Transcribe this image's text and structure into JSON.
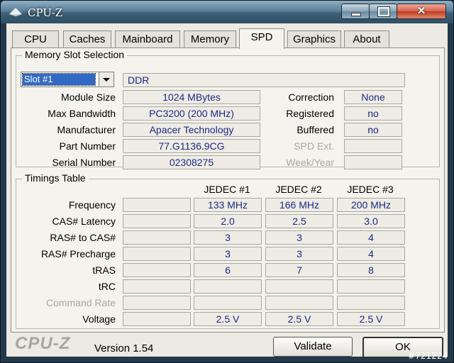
{
  "window": {
    "title": "CPU-Z",
    "close_glyph": "✕"
  },
  "tabs": [
    "CPU",
    "Caches",
    "Mainboard",
    "Memory",
    "SPD",
    "Graphics",
    "About"
  ],
  "active_tab": "SPD",
  "slot": {
    "group_title": "Memory Slot Selection",
    "selected": "Slot #1",
    "type": "DDR",
    "rows": [
      {
        "label": "Module Size",
        "value": "1024 MBytes"
      },
      {
        "label": "Max Bandwidth",
        "value": "PC3200 (200 MHz)"
      },
      {
        "label": "Manufacturer",
        "value": "Apacer Technology"
      },
      {
        "label": "Part Number",
        "value": "77.G1136.9CG"
      },
      {
        "label": "Serial Number",
        "value": "02308275"
      }
    ],
    "right_rows": [
      {
        "label": "Correction",
        "value": "None",
        "enabled": true
      },
      {
        "label": "Registered",
        "value": "no",
        "enabled": true
      },
      {
        "label": "Buffered",
        "value": "no",
        "enabled": true
      },
      {
        "label": "SPD Ext.",
        "value": "",
        "enabled": false
      },
      {
        "label": "Week/Year",
        "value": "",
        "enabled": false
      }
    ]
  },
  "timings": {
    "group_title": "Timings Table",
    "columns": [
      "JEDEC #1",
      "JEDEC #2",
      "JEDEC #3"
    ],
    "rows": [
      {
        "label": "Frequency",
        "values": [
          "133 MHz",
          "166 MHz",
          "200 MHz"
        ],
        "enabled": true
      },
      {
        "label": "CAS# Latency",
        "values": [
          "2.0",
          "2.5",
          "3.0"
        ],
        "enabled": true
      },
      {
        "label": "RAS# to CAS#",
        "values": [
          "3",
          "3",
          "4"
        ],
        "enabled": true
      },
      {
        "label": "RAS# Precharge",
        "values": [
          "3",
          "3",
          "4"
        ],
        "enabled": true
      },
      {
        "label": "tRAS",
        "values": [
          "6",
          "7",
          "8"
        ],
        "enabled": true
      },
      {
        "label": "tRC",
        "values": [
          "",
          "",
          ""
        ],
        "enabled": true
      },
      {
        "label": "Command Rate",
        "values": [
          "",
          "",
          ""
        ],
        "enabled": false
      },
      {
        "label": "Voltage",
        "values": [
          "2.5 V",
          "2.5 V",
          "2.5 V"
        ],
        "enabled": true
      }
    ]
  },
  "footer": {
    "brand": "CPU-Z",
    "version": "Version 1.54",
    "validate": "Validate",
    "ok": "OK"
  },
  "watermark": "#721224"
}
